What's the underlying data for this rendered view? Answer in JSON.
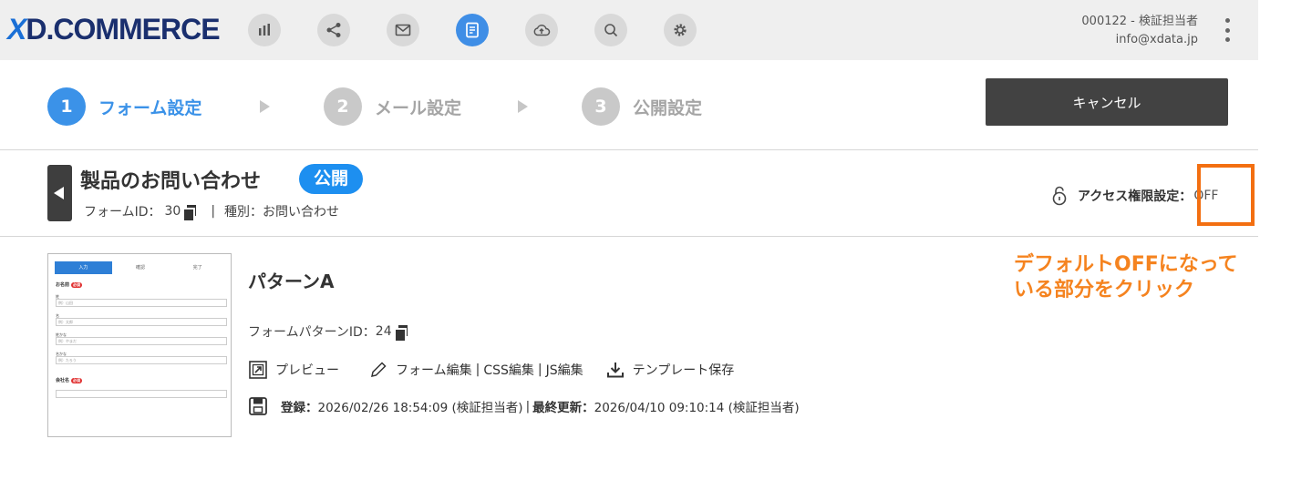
{
  "header": {
    "logo_x": "X",
    "logo_rest": "D.COMMERCE",
    "nav_icons": [
      "chart-icon",
      "share-icon",
      "mail-icon",
      "form-icon",
      "cloud-upload-icon",
      "search-icon",
      "gear-icon"
    ],
    "user_line1": "000122 - 検証担当者",
    "user_line2": "info@xdata.jp"
  },
  "steps": [
    {
      "num": "1",
      "label": "フォーム設定"
    },
    {
      "num": "2",
      "label": "メール設定"
    },
    {
      "num": "3",
      "label": "公開設定"
    }
  ],
  "cancel_label": "キャンセル",
  "form": {
    "title": "製品のお問い合わせ",
    "status_badge": "公開",
    "id_label": "フォームID：",
    "id_value": "30",
    "separator": "|",
    "type_text": "種別：お問い合わせ"
  },
  "access": {
    "label": "アクセス権限設定：",
    "value": "OFF"
  },
  "annotation": "デフォルトOFFになって\nいる部分をクリック",
  "pattern": {
    "name": "パターンA",
    "id_label": "フォームパターンID：",
    "id_value": "24",
    "actions": {
      "preview": "プレビュー",
      "form_edit": "フォーム編集",
      "css_edit": "CSS編集",
      "js_edit": "JS編集",
      "template_save": "テンプレート保存",
      "sep": "|"
    },
    "registered_label": "登録：",
    "registered_value": "2026/02/26 18:54:09 (検証担当者)",
    "updated_label": "最終更新：",
    "updated_value": "2026/04/10 09:10:14 (検証担当者)"
  },
  "thumbnail": {
    "steps": [
      "入力",
      "確認",
      "完了"
    ],
    "required_badge": "必須",
    "name_label": "お名前",
    "last_name": "姓",
    "last_name_ph": "例）山田",
    "first_name": "名",
    "first_name_ph": "例）太郎",
    "last_kana": "姓かな",
    "last_kana_ph": "例）やまだ",
    "first_kana": "名かな",
    "first_kana_ph": "例）たろう",
    "company_label": "会社名"
  },
  "colors": {
    "accent": "#3b92e8",
    "badge": "#1d8ff0",
    "highlight": "#f36f11",
    "annotation": "#f5831f"
  }
}
